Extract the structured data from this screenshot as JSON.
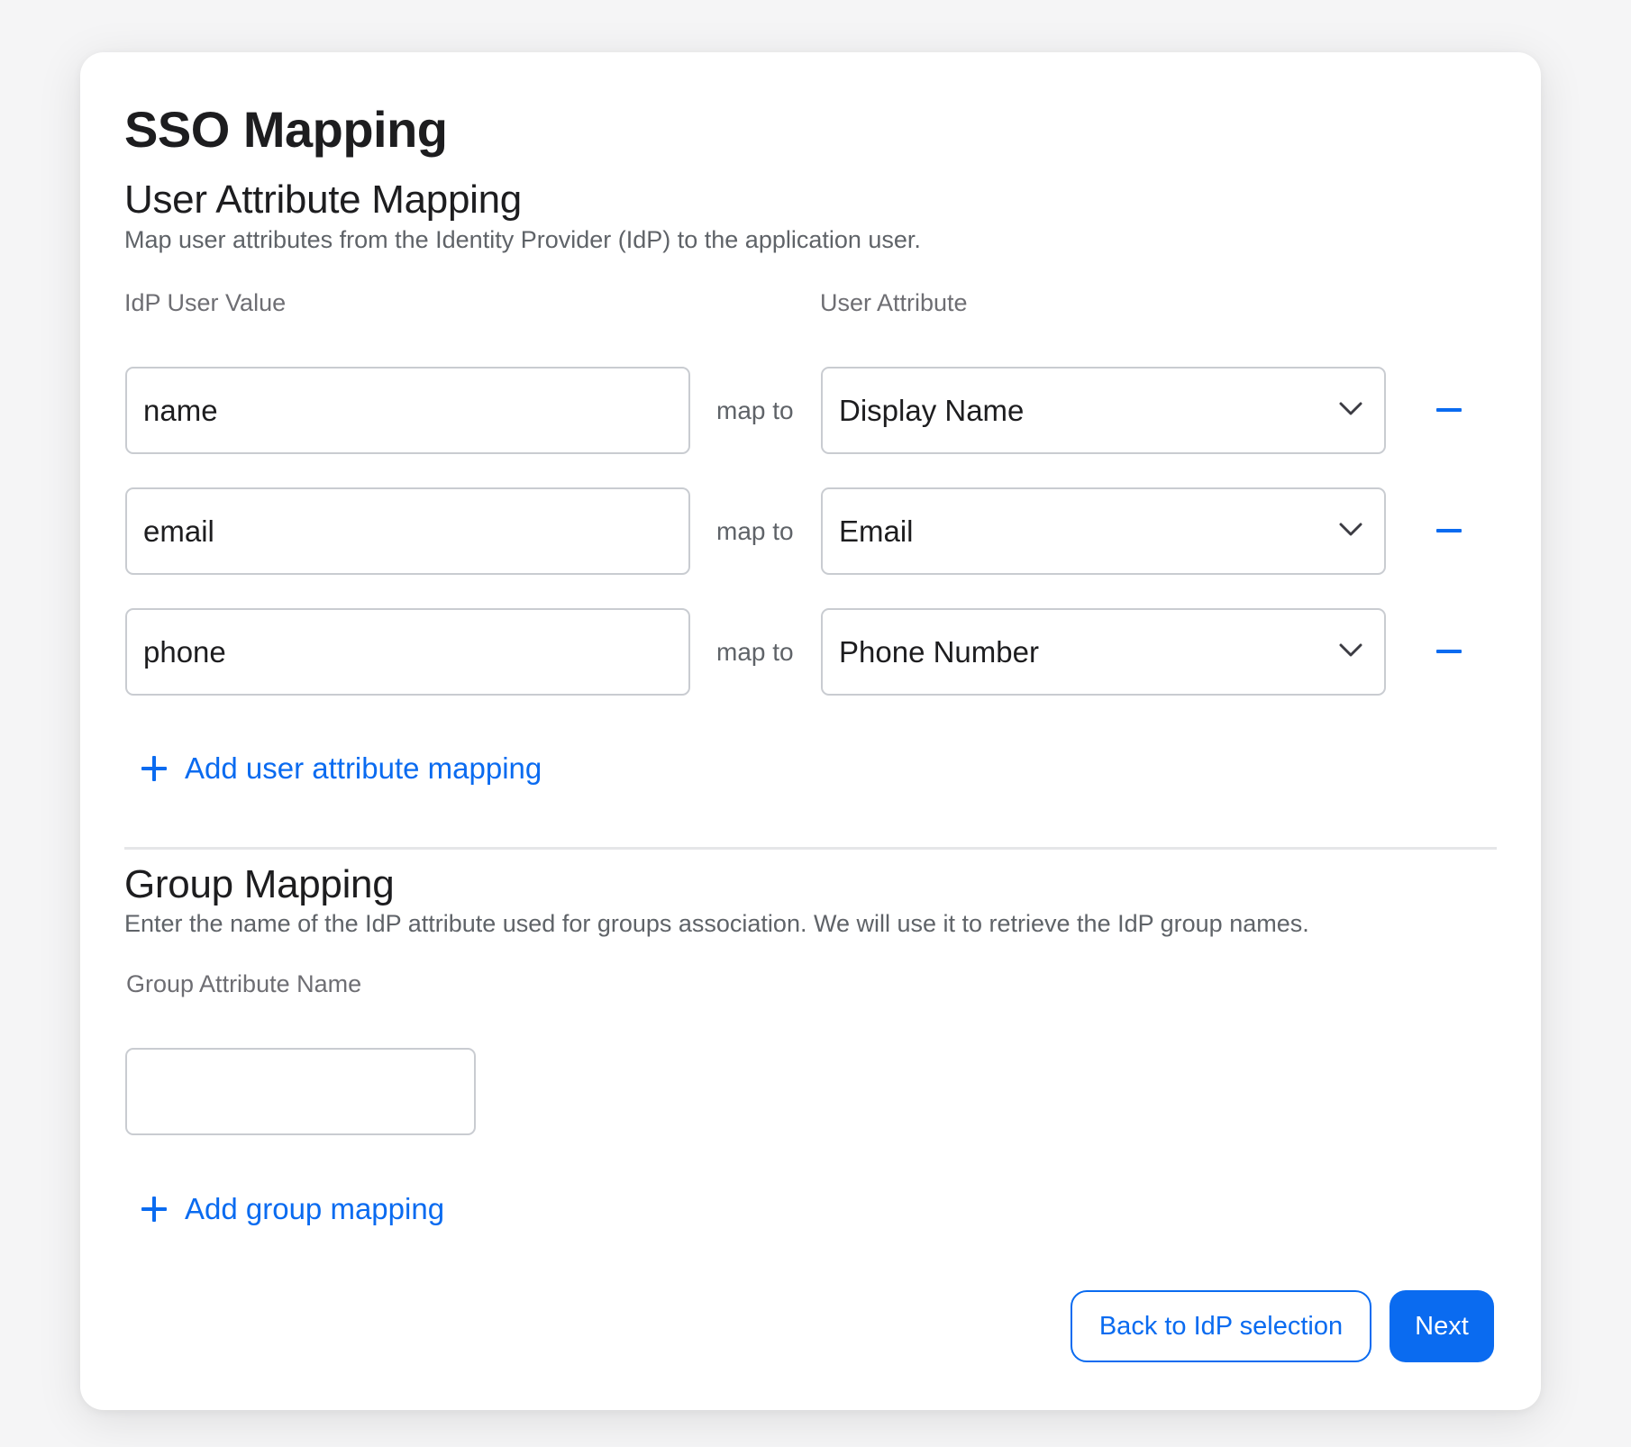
{
  "page": {
    "title": "SSO Mapping"
  },
  "user_attribute_mapping": {
    "title": "User Attribute Mapping",
    "description": "Map user attributes from the Identity Provider (IdP) to the application user.",
    "idp_column_label": "IdP User Value",
    "attribute_column_label": "User Attribute",
    "connector_label": "map to",
    "rows": [
      {
        "idp_value": "name",
        "attribute": "Display Name"
      },
      {
        "idp_value": "email",
        "attribute": "Email"
      },
      {
        "idp_value": "phone",
        "attribute": "Phone Number"
      }
    ],
    "add_label": "Add user attribute mapping"
  },
  "group_mapping": {
    "title": "Group Mapping",
    "description": "Enter the name of the IdP attribute used for groups association. We will use it to retrieve the IdP group names.",
    "field_label": "Group Attribute Name",
    "field_value": "",
    "add_label": "Add group mapping"
  },
  "footer": {
    "back_label": "Back to IdP selection",
    "next_label": "Next"
  },
  "icons": {
    "chevron": "chevron-down-icon",
    "remove": "minus-icon",
    "add": "plus-icon"
  },
  "colors": {
    "accent": "#0a6bf0",
    "border": "#c9ccd1",
    "text": "#1d1d1f",
    "muted": "#5f6368"
  }
}
